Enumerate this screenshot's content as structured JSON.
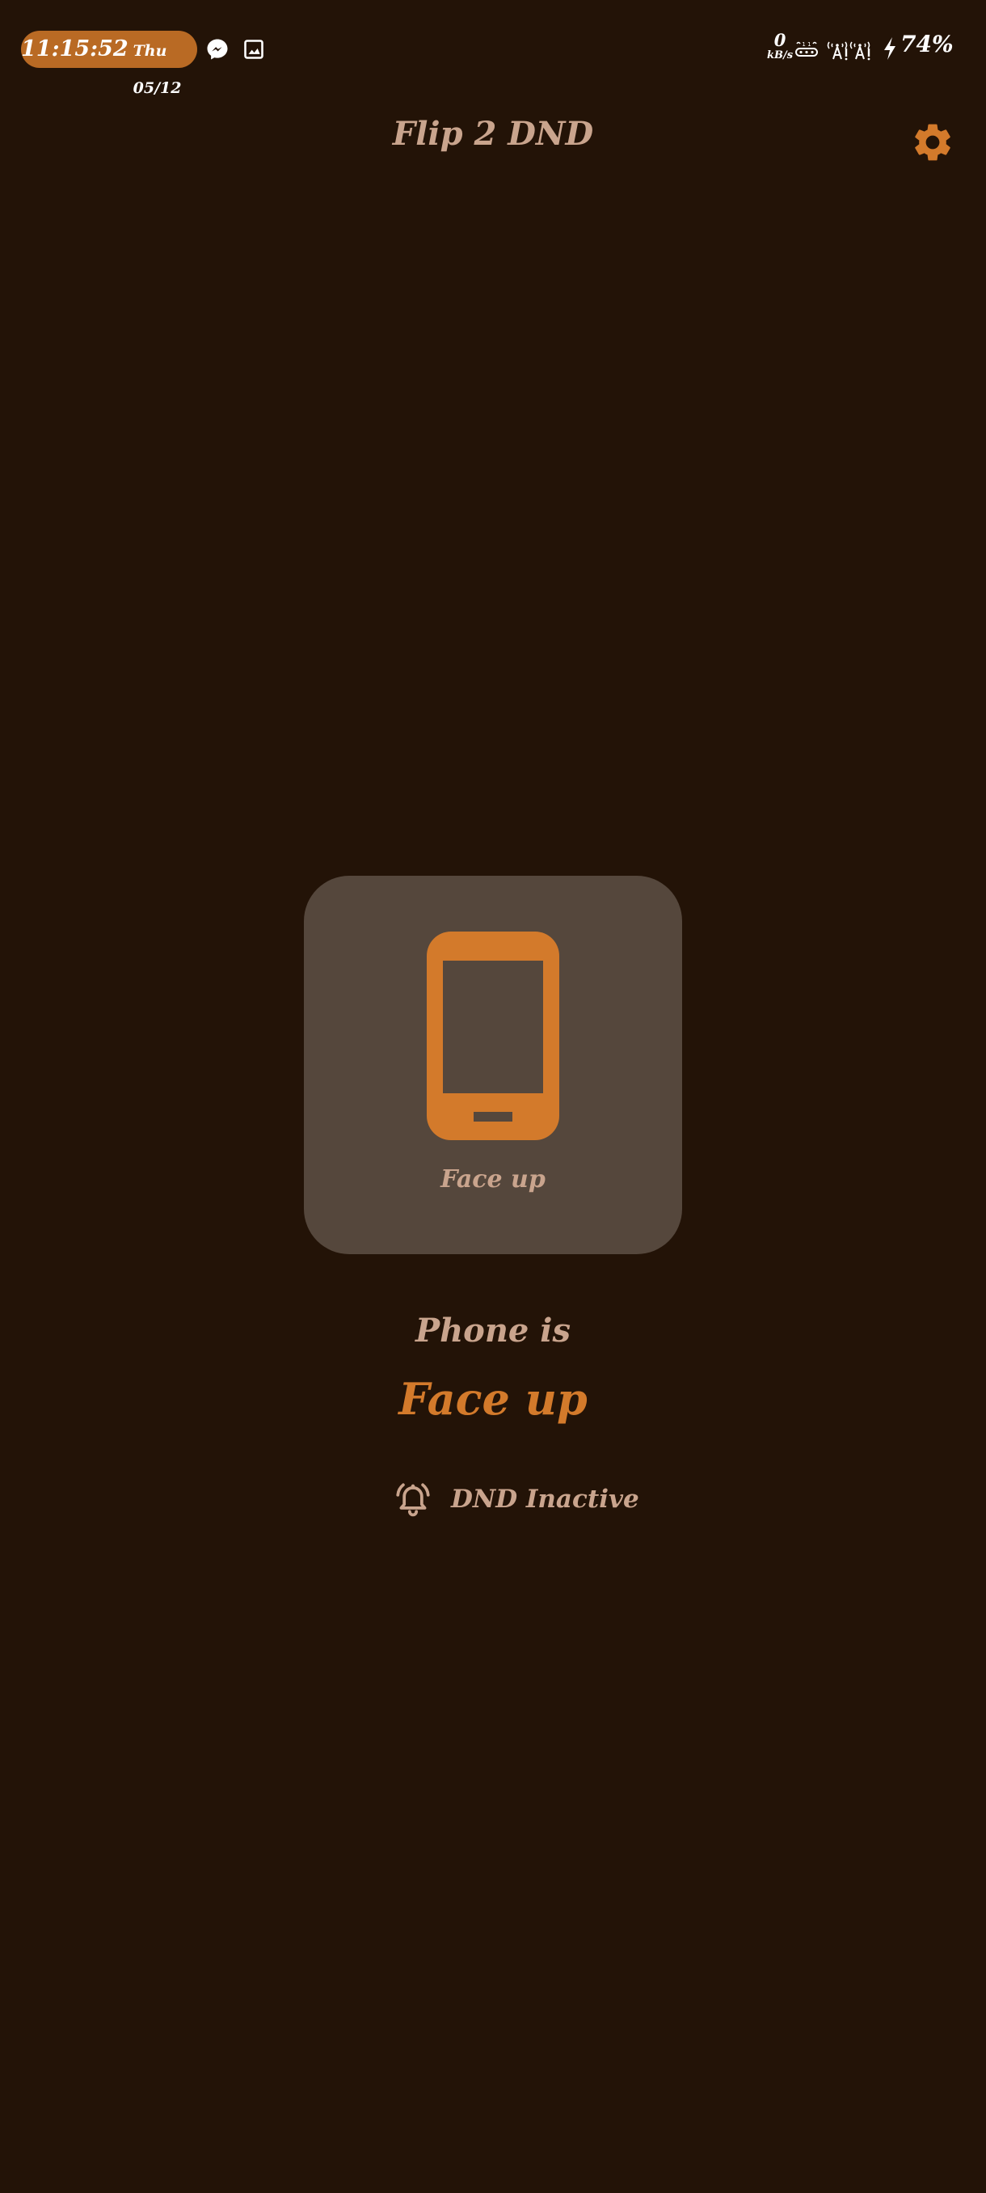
{
  "status_bar": {
    "time": "11:15:52",
    "date": "Thu 05/12",
    "net_speed_value": "0",
    "net_speed_unit": "kB/s",
    "battery": "74%",
    "icons": [
      "messenger-icon",
      "gallery-icon",
      "volte-icon",
      "signal-icon",
      "signal-icon",
      "charging-icon"
    ]
  },
  "header": {
    "title": "Flip 2 DND",
    "settings_icon": "gear-icon"
  },
  "card": {
    "icon": "phone-icon",
    "label": "Face up"
  },
  "status": {
    "prefix": "Phone is",
    "orientation": "Face up",
    "dnd_icon": "bell-alert-icon",
    "dnd_label": "DND Inactive"
  },
  "colors": {
    "background": "#231307",
    "accent": "#d37a2b",
    "text_muted": "#c9a48d",
    "card": "#55473c",
    "time_pill": "#b96a24"
  }
}
